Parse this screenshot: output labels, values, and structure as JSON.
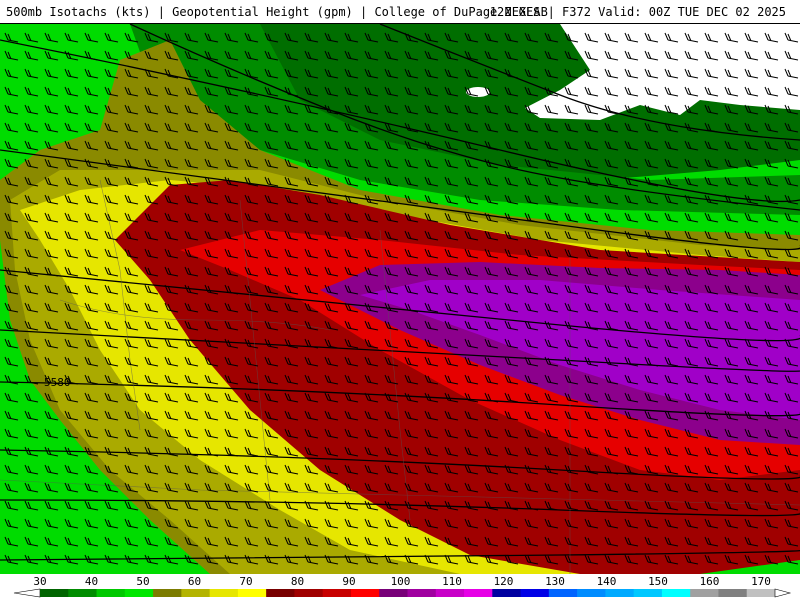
{
  "header": {
    "left": "500mb Isotachs (kts) | Geopotential Height (gpm) | College of DuPage NEXLAB",
    "right": "12Z GFS | F372 Valid: 00Z TUE DEC 02 2025"
  },
  "map": {
    "contour_label": "5580"
  },
  "colors": {
    "w30": "#006400",
    "w40": "#008c00",
    "w50": "#00c800",
    "w60": "#7c7c00",
    "w70": "#b4b400",
    "w80": "#e6e600",
    "w90": "#a00000",
    "w100": "#e60000",
    "w110": "#8c008c",
    "w120": "#a000c8",
    "w130": "#e600e6",
    "w140": "#0000c8",
    "w150": "#008cff",
    "w160": "#00c8ff",
    "w170": "#a0a0a0"
  },
  "colorbar": {
    "labels": [
      "30",
      "40",
      "50",
      "60",
      "70",
      "80",
      "90",
      "100",
      "110",
      "120",
      "130",
      "140",
      "150",
      "160",
      "170"
    ],
    "swatches": [
      "#006400",
      "#008c00",
      "#00c800",
      "#00e600",
      "#7c7c00",
      "#b4b400",
      "#e6e600",
      "#ffff00",
      "#780000",
      "#a00000",
      "#c80000",
      "#ff0000",
      "#780078",
      "#a000a0",
      "#c800c8",
      "#e600e6",
      "#0000a0",
      "#0000e6",
      "#0064ff",
      "#008cff",
      "#00aaff",
      "#00c8ff",
      "#00ffff",
      "#a0a0a0",
      "#808080",
      "#c0c0c0"
    ]
  }
}
